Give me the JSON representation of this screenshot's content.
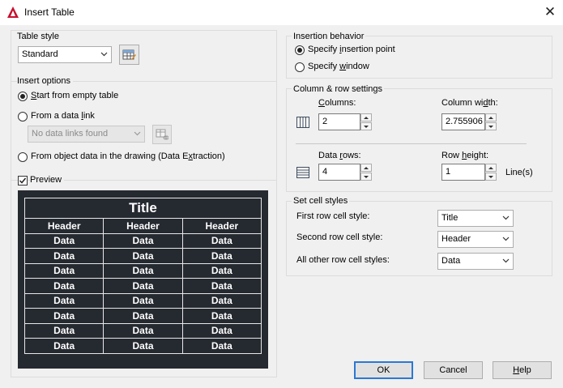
{
  "window": {
    "title": "Insert Table",
    "close_glyph": "✕"
  },
  "table_style": {
    "group_label": "Table style",
    "selected": "Standard",
    "launch_icon": "table-style-dialog-icon"
  },
  "insert_options": {
    "group_label": "Insert options",
    "start_empty": {
      "label_pre": "",
      "label_ul": "S",
      "label_post": "tart from empty table",
      "checked": true
    },
    "from_data_link": {
      "label_pre": "From a data ",
      "label_ul": "l",
      "label_post": "ink",
      "checked": false
    },
    "data_link_value": "No data links found",
    "from_object": {
      "label_pre": "From object data in the drawing (Data E",
      "label_ul": "x",
      "label_post": "traction)",
      "checked": false
    }
  },
  "preview": {
    "label": "Preview",
    "checked": true,
    "title": "Title",
    "headers": [
      "Header",
      "Header",
      "Header"
    ],
    "rows": [
      [
        "Data",
        "Data",
        "Data"
      ],
      [
        "Data",
        "Data",
        "Data"
      ],
      [
        "Data",
        "Data",
        "Data"
      ],
      [
        "Data",
        "Data",
        "Data"
      ],
      [
        "Data",
        "Data",
        "Data"
      ],
      [
        "Data",
        "Data",
        "Data"
      ],
      [
        "Data",
        "Data",
        "Data"
      ],
      [
        "Data",
        "Data",
        "Data"
      ]
    ]
  },
  "insertion_behavior": {
    "group_label": "Insertion behavior",
    "insertion_point": {
      "label_pre": "Specify ",
      "label_ul": "i",
      "label_post": "nsertion point",
      "checked": true
    },
    "window": {
      "label_pre": "Specify ",
      "label_ul": "w",
      "label_post": "indow",
      "checked": false
    }
  },
  "colrow": {
    "group_label": "Column & row settings",
    "columns_label_pre": "",
    "columns_label_ul": "C",
    "columns_label_post": "olumns:",
    "columns_value": "2",
    "column_width_label_pre": "Column wi",
    "column_width_label_ul": "d",
    "column_width_label_post": "th:",
    "column_width_value": "2.755906",
    "data_rows_label_pre": "Data ",
    "data_rows_label_ul": "r",
    "data_rows_label_post": "ows:",
    "data_rows_value": "4",
    "row_height_label_pre": "Row ",
    "row_height_label_ul": "h",
    "row_height_label_post": "eight:",
    "row_height_value": "1",
    "row_height_unit": "Line(s)"
  },
  "cell_styles": {
    "group_label": "Set cell styles",
    "first_row_label": "First row cell style:",
    "first_row_value": "Title",
    "second_row_label": "Second row cell style:",
    "second_row_value": "Header",
    "other_rows_label": "All other row cell styles:",
    "other_rows_value": "Data"
  },
  "buttons": {
    "ok": "OK",
    "cancel": "Cancel",
    "help_ul": "H",
    "help_post": "elp"
  },
  "colors": {
    "accent": "#2b78d3",
    "preview_bg": "#252930",
    "app_icon_red": "#c8102e"
  }
}
